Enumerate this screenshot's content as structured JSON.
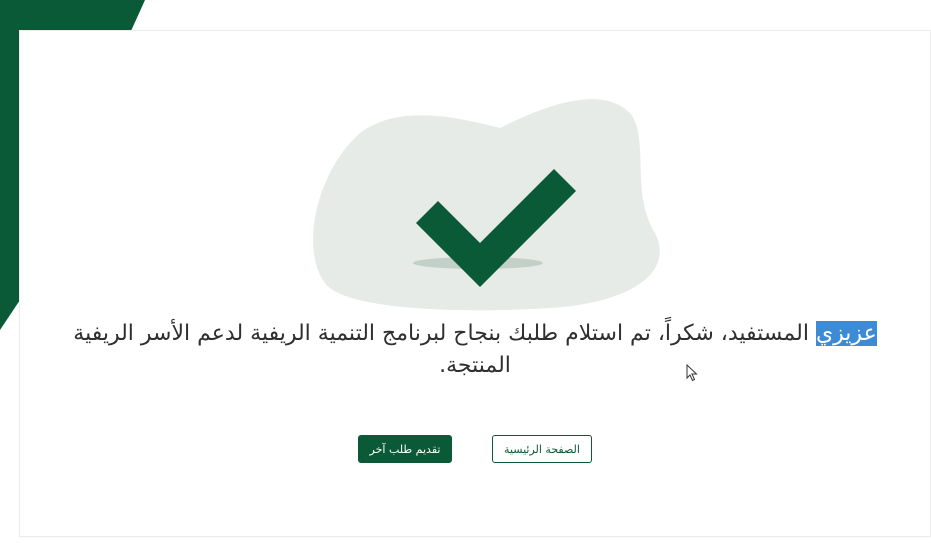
{
  "colors": {
    "brand_green": "#0b5a37",
    "blob_fill": "#e6ebe7",
    "selection_highlight": "#3d8bd4",
    "text": "#2f2f2f"
  },
  "illustration": {
    "icon": "checkmark-icon"
  },
  "message": {
    "highlighted_word": "عزيزي",
    "rest_text": " المستفيد، شكراً، تم استلام طلبك بنجاح لبرنامج التنمية الريفية لدعم الأسر الريفية المنتجة."
  },
  "buttons": {
    "home_label": "الصفحة الرئيسية",
    "new_request_label": "تقديم طلب آخر"
  }
}
